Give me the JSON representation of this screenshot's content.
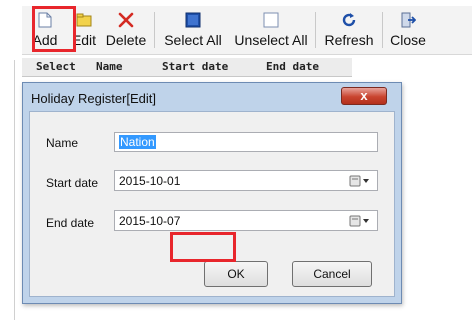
{
  "toolbar": {
    "buttons": [
      {
        "label": "Add",
        "icon": "new-document-icon"
      },
      {
        "label": "Edit",
        "icon": "edit-folder-icon"
      },
      {
        "label": "Delete",
        "icon": "delete-x-icon"
      },
      {
        "label": "Select All",
        "icon": "select-all-icon"
      },
      {
        "label": "Unselect All",
        "icon": "unselect-all-icon"
      },
      {
        "label": "Refresh",
        "icon": "refresh-icon"
      },
      {
        "label": "Close",
        "icon": "exit-icon"
      }
    ],
    "highlight_color": "#e8262c"
  },
  "grid": {
    "columns": [
      "Select",
      "Name",
      "Start date",
      "End date"
    ]
  },
  "dialog": {
    "title": "Holiday Register[Edit]",
    "close_label": "x",
    "fields": {
      "name_label": "Name",
      "name_value": "Nation",
      "start_label": "Start date",
      "start_value": "2015-10-01",
      "end_label": "End date",
      "end_value": "2015-10-07"
    },
    "ok_label": "OK",
    "cancel_label": "Cancel"
  },
  "colors": {
    "dialog_frame": "#bfd3ea",
    "close_button": "#c9442f",
    "selection": "#3399ff"
  }
}
